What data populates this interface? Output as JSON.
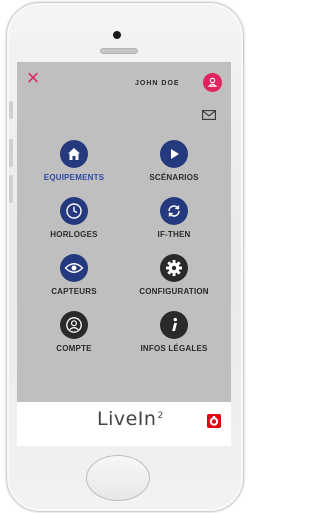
{
  "header": {
    "user_name": "JOHN DOE"
  },
  "menu": {
    "items": [
      {
        "label": "EQUIPEMENTS",
        "icon": "home-icon",
        "active": true
      },
      {
        "label": "SCÉNARIOS",
        "icon": "play-icon",
        "active": false
      },
      {
        "label": "HORLOGES",
        "icon": "clock-icon",
        "active": false
      },
      {
        "label": "IF-THEN",
        "icon": "sync-icon",
        "active": false
      },
      {
        "label": "CAPTEURS",
        "icon": "eye-icon",
        "active": false
      },
      {
        "label": "CONFIGURATION",
        "icon": "gear-icon",
        "active": false
      },
      {
        "label": "COMPTE",
        "icon": "user-icon",
        "active": false
      },
      {
        "label": "INFOS LÉGALES",
        "icon": "info-icon",
        "active": false
      }
    ]
  },
  "footer": {
    "logo_text": "LiveIn",
    "logo_superscript": "2"
  },
  "colors": {
    "accent": "#e0245e",
    "blue": "#253a7e",
    "active_label": "#2d4aa8",
    "dark": "#2a2a2a",
    "screen_bg": "#bfbfbf"
  }
}
